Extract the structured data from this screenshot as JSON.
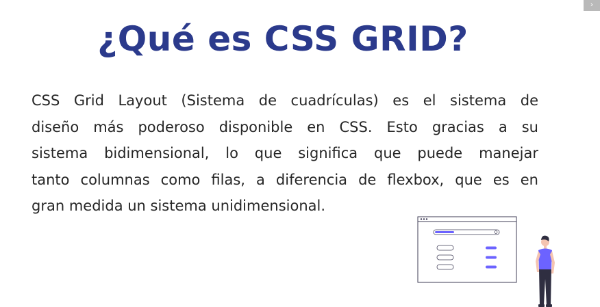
{
  "slide": {
    "title": "¿Qué es CSS GRID?",
    "paragraph_lines": [
      "CSS Grid Layout  (Sistema de cuadrículas) es el sistema de",
      "diseño más poderoso disponible en CSS. Esto gracias a su",
      "sistema bidimensional, lo que significa que puede manejar",
      "tanto columnas como filas, a diferencia de flexbox, que es en",
      "gran medida un sistema unidimensional."
    ]
  },
  "corner_control": {
    "icon": "chevron-right-icon",
    "glyph": "›"
  },
  "illustration": {
    "icon": "person-with-browser-window-illustration",
    "accent_color": "#6c63ff",
    "title_color": "#2b3a8c"
  }
}
